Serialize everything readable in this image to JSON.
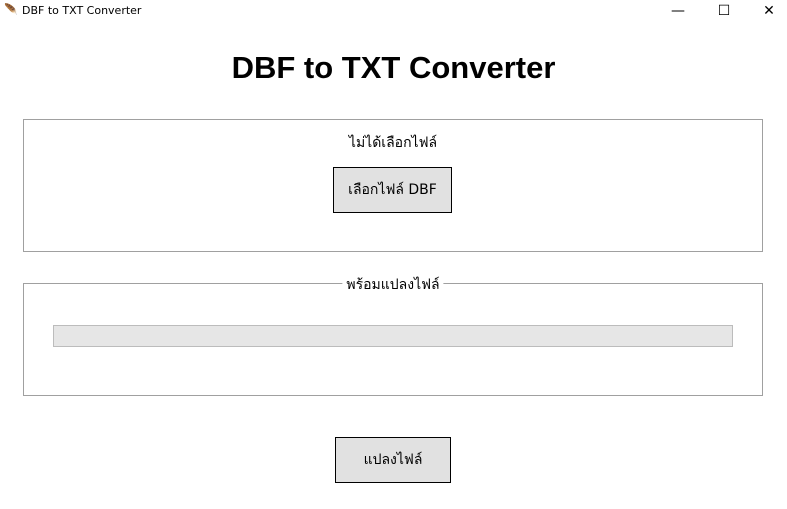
{
  "window": {
    "title": "DBF to TXT Converter",
    "minimize": "—",
    "maximize": "☐",
    "close": "✕"
  },
  "header": {
    "title": "DBF to TXT Converter"
  },
  "file_section": {
    "status": "ไม่ได้เลือกไฟล์",
    "select_button": "เลือกไฟล์ DBF"
  },
  "progress_section": {
    "status": "พร้อมแปลงไฟล์",
    "progress_percent": 0
  },
  "convert_button": "แปลงไฟล์"
}
